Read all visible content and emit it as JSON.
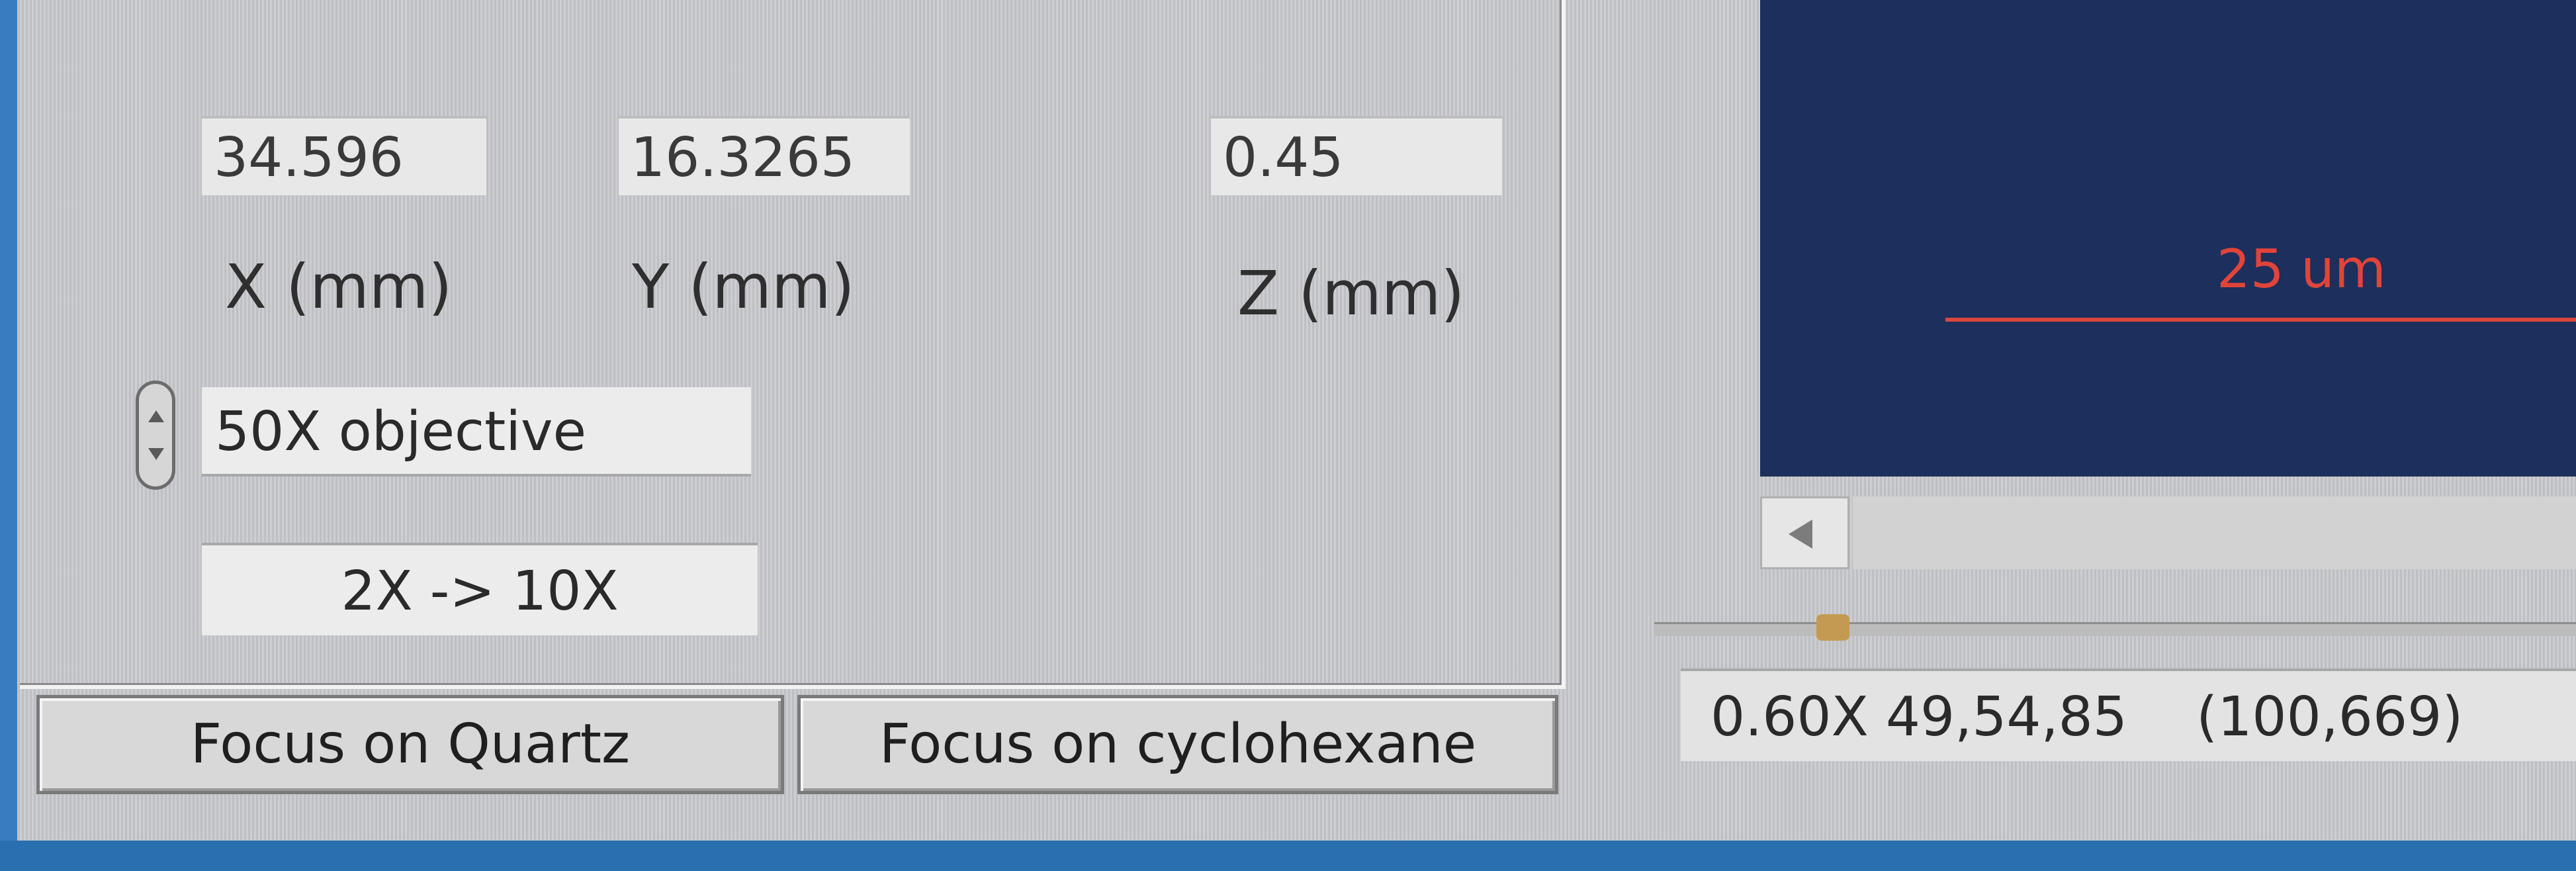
{
  "position": {
    "x_value": "34.596",
    "y_value": "16.3265",
    "z_value": "0.45",
    "x_label": "X (mm)",
    "y_label": "Y (mm)",
    "z_label": "Z (mm)"
  },
  "objective": {
    "selected": "50X objective",
    "toggle_label": "2X -> 10X"
  },
  "buttons": {
    "focus_quartz": "Focus on Quartz",
    "focus_cyclohexane": "Focus on cyclohexane"
  },
  "viewer": {
    "scale_bar_label": "25 um"
  },
  "status": {
    "text": "0.60X 49,54,85    (100,669)"
  },
  "colors": {
    "viewer_background": "#1d2f5c",
    "scale_bar": "#d9463c",
    "panel": "#c7c9cc"
  }
}
